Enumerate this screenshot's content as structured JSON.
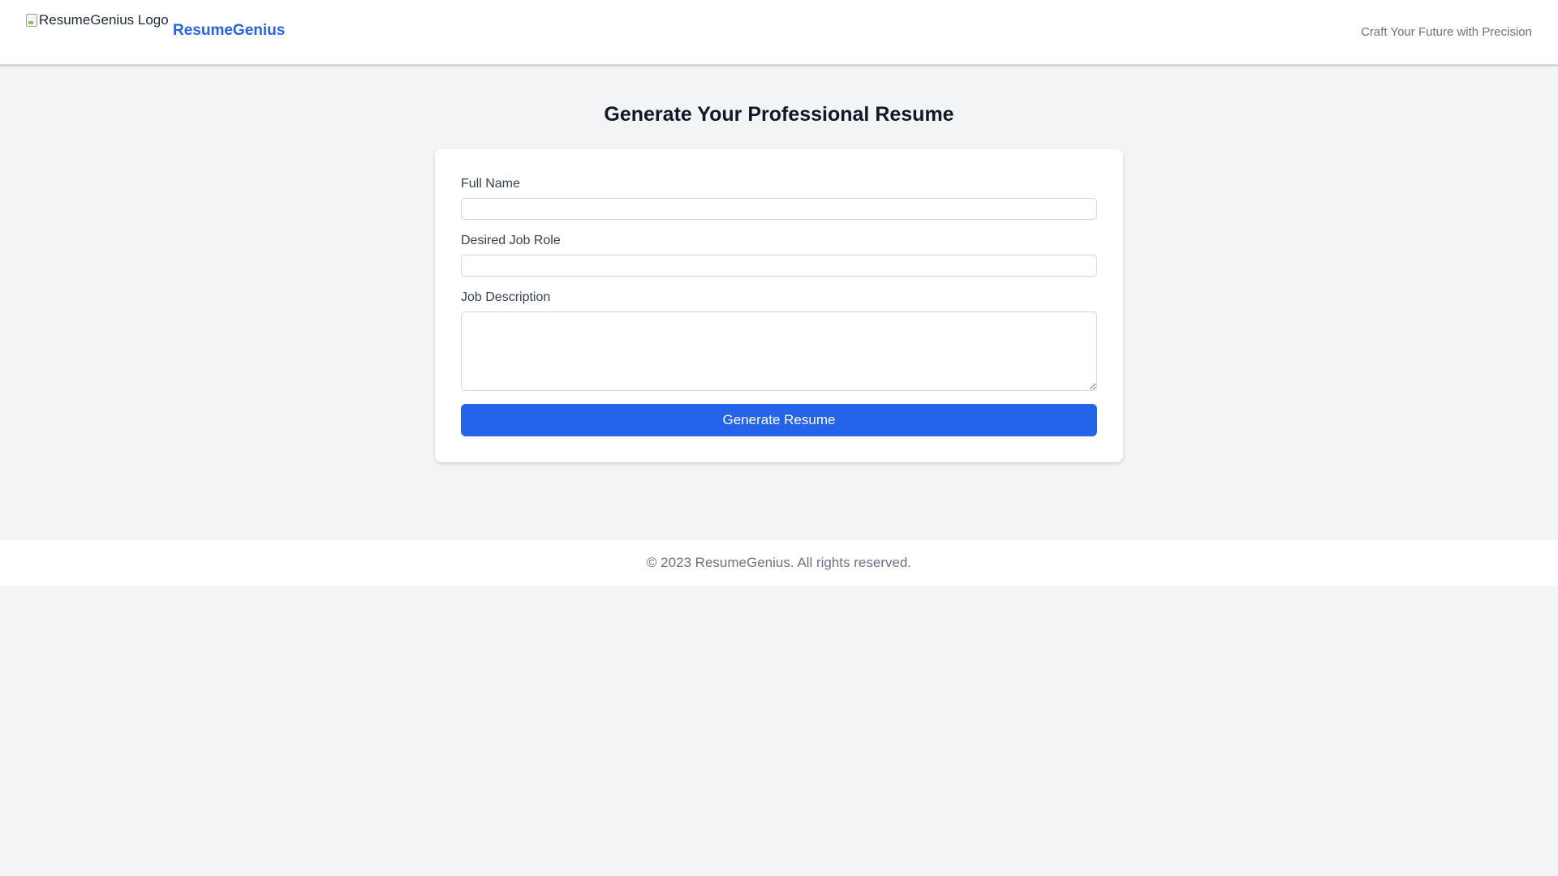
{
  "header": {
    "logo_alt": "ResumeGenius Logo",
    "brand": "ResumeGenius",
    "tagline": "Craft Your Future with Precision"
  },
  "main": {
    "title": "Generate Your Professional Resume",
    "form": {
      "full_name": {
        "label": "Full Name",
        "value": "",
        "placeholder": ""
      },
      "job_role": {
        "label": "Desired Job Role",
        "value": "",
        "placeholder": ""
      },
      "job_description": {
        "label": "Job Description",
        "value": "",
        "placeholder": ""
      },
      "submit_label": "Generate Resume"
    }
  },
  "footer": {
    "copyright": "© 2023 ResumeGenius. All rights reserved."
  },
  "colors": {
    "accent": "#2563eb",
    "background": "#f3f4f6",
    "surface": "#ffffff",
    "muted_text": "#6b7280"
  },
  "icons": {
    "logo": "broken-image-icon"
  }
}
